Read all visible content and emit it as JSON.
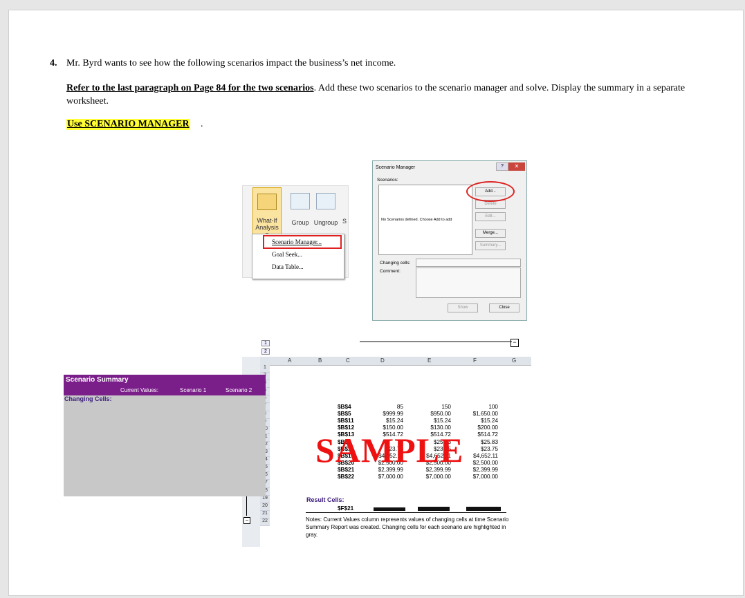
{
  "question": {
    "number": "4.",
    "text": "Mr. Byrd wants to see how the following scenarios impact the business’s net income.",
    "instruction_bold": "Refer to the last paragraph on Page 84 for the two scenarios",
    "instruction_rest": ". Add these two scenarios to the scenario manager and solve. Display the summary in a separate worksheet.",
    "highlight": "Use SCENARIO MANAGER",
    "highlight_end": "."
  },
  "ribbon": {
    "whatif_label": "What-If",
    "analysis_label": "Analysis ▾",
    "group_label": "Group",
    "ungroup_label": "Ungroup",
    "s_label": "S",
    "menu_items": [
      "Scenario Manager...",
      "Goal Seek...",
      "Data Table..."
    ]
  },
  "dialog": {
    "title": "Scenario Manager",
    "scenarios_label": "Scenarios:",
    "empty_msg": "No Scenarios defined. Choose Add to add",
    "buttons": [
      "Add...",
      "Delete",
      "Edit...",
      "Merge...",
      "Summary..."
    ],
    "changing_cells_label": "Changing cells:",
    "comment_label": "Comment:",
    "show_label": "Show",
    "close_label": "Close",
    "help_glyph": "?",
    "close_glyph": "✕"
  },
  "sheet": {
    "columns": [
      "A",
      "B",
      "C",
      "D",
      "E",
      "F",
      "G"
    ],
    "rows": [
      "1",
      "2",
      "3",
      "5",
      "6",
      "7",
      "8",
      "9",
      "10",
      "11",
      "12",
      "13",
      "14",
      "15",
      "16",
      "17",
      "18",
      "19",
      "20",
      "21",
      "22"
    ],
    "outline_levels": [
      "1",
      "2"
    ],
    "title": "Scenario Summary",
    "col_headers": [
      "Current Values:",
      "Scenario 1",
      "Scenario 2"
    ],
    "changing_cells_label": "Changing Cells:",
    "result_cells_label": "Result Cells:",
    "table": [
      [
        "$B$4",
        "85",
        "150",
        "100"
      ],
      [
        "$B$5",
        "$999.99",
        "$950.00",
        "$1,650.00"
      ],
      [
        "$B$11",
        "$15.24",
        "$15.24",
        "$15.24"
      ],
      [
        "$B$12",
        "$150.00",
        "$130.00",
        "$200.00"
      ],
      [
        "$B$13",
        "$514.72",
        "$514.72",
        "$514.72"
      ],
      [
        "$B$",
        "",
        "$25.83",
        "$25.83"
      ],
      [
        "$B$1",
        "$23.75",
        "$23.75",
        "$23.75"
      ],
      [
        "$B$19",
        "$4,652.11",
        "$4,652.11",
        "$4,652.11"
      ],
      [
        "$B$20",
        "$2,500.00",
        "$2,500.00",
        "$2,500.00"
      ],
      [
        "$B$21",
        "$2,399.99",
        "$2,399.99",
        "$2,399.99"
      ],
      [
        "$B$22",
        "$7,000.00",
        "$7,000.00",
        "$7,000.00"
      ]
    ],
    "result_row": "$F$21",
    "notes": "Notes:  Current Values column represents values of changing cells at time Scenario Summary Report was created.  Changing cells for each scenario are highlighted in gray.",
    "watermark": "SAMPLE"
  },
  "colors": {
    "accent_purple": "#7a1e8a",
    "highlight_yellow": "#ffff33",
    "red_mark": "#e02020"
  }
}
